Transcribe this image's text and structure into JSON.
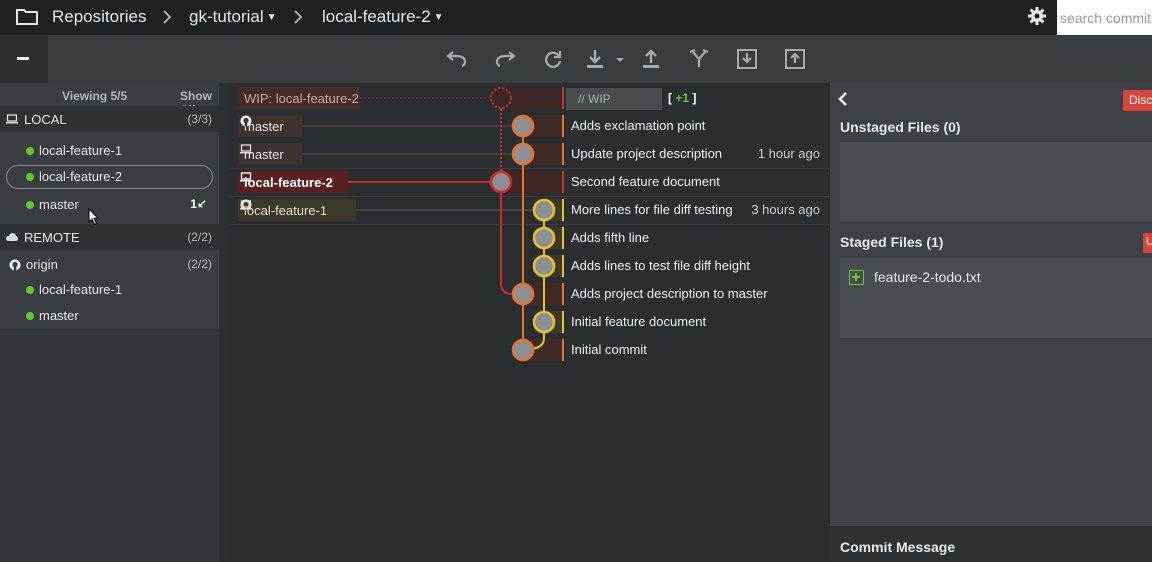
{
  "topbar": {
    "repositories": "Repositories",
    "repo": "gk-tutorial",
    "branch": "local-feature-2",
    "search_placeholder": "search commits"
  },
  "left": {
    "viewing": "Viewing 5/5",
    "show_all": "Show All",
    "local_label": "LOCAL",
    "local_count": "(3/3)",
    "local_branches": [
      "local-feature-1",
      "local-feature-2",
      "master"
    ],
    "master_ahead": "1↙",
    "remote_label": "REMOTE",
    "remote_count": "(2/2)",
    "origin": "origin",
    "origin_count": "(2/2)",
    "remote_branches": [
      "local-feature-1",
      "master"
    ]
  },
  "graph": {
    "wip_ref": "WIP: local-feature-2",
    "wip_placeholder": "// WIP",
    "wip_plus": "+1",
    "refs": {
      "r1": "master",
      "r2": "master",
      "r3": "local-feature-2",
      "r4": "local-feature-1"
    },
    "commits": [
      "Adds exclamation point",
      "Update project description",
      "Second feature document",
      "More lines for file diff testing",
      "Adds fifth line",
      "Adds lines to test file diff height",
      "Adds project description to master",
      "Initial feature document",
      "Initial commit"
    ],
    "times": {
      "t1": "1 hour ago",
      "t3": "3 hours ago"
    }
  },
  "right": {
    "discard": "Disc",
    "unstaged": "Unstaged Files (0)",
    "staged": "Staged Files (1)",
    "unstage_btn": "U",
    "file": "feature-2-todo.txt",
    "commit_message": "Commit Message"
  }
}
